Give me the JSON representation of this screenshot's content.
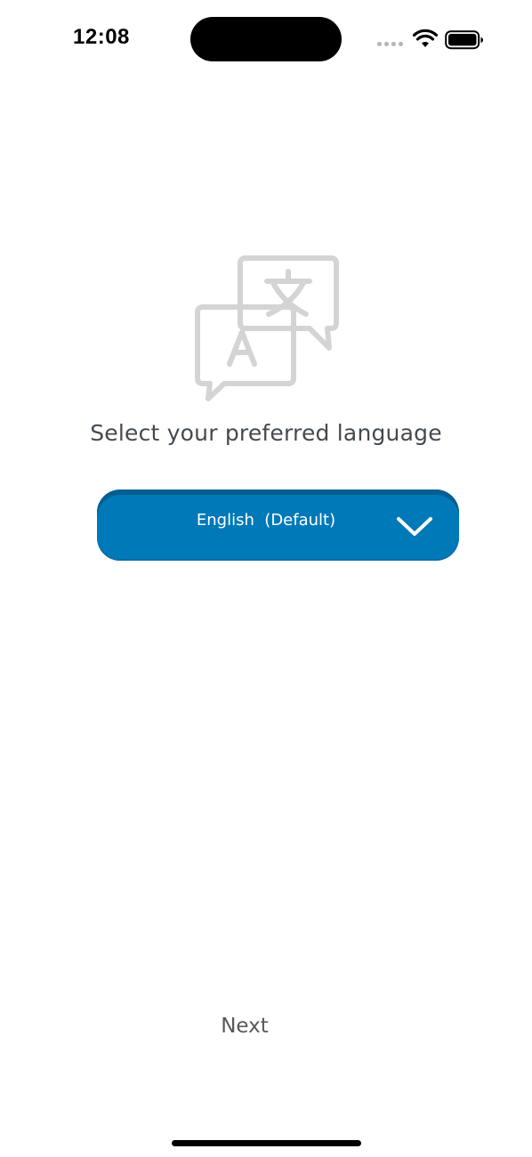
{
  "status_bar": {
    "time": "12:08"
  },
  "main": {
    "icon": "translate-icon",
    "prompt": "Select your preferred language",
    "language_select": {
      "selected": "English  (Default)"
    },
    "next_label": "Next"
  },
  "colors": {
    "accent": "#0079b8",
    "icon_gray": "#d4d4d4",
    "text_gray": "#444a4f"
  }
}
